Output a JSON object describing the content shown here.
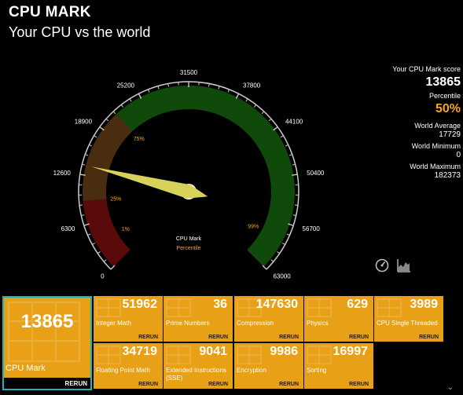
{
  "header": {
    "title": "CPU MARK",
    "subtitle": "Your CPU vs the world"
  },
  "gauge": {
    "min": 0,
    "max": 63000,
    "tick_labels": [
      "0",
      "6300",
      "12600",
      "18900",
      "25200",
      "31500",
      "37800",
      "44100",
      "50400",
      "56700",
      "63000"
    ],
    "percentile_marks": [
      {
        "label": "1%",
        "value": 3400
      },
      {
        "label": "25%",
        "value": 9300
      },
      {
        "label": "75%",
        "value": 21500
      },
      {
        "label": "99%",
        "value": 59000
      }
    ],
    "needle_value": 13865,
    "center_label": "CPU Mark",
    "center_sublabel": "Percentile",
    "colors": {
      "low": "#5a0a0a",
      "mid": "#4a2c10",
      "high": "#0f4a0a",
      "needle": "#d9d25a",
      "percent_text": "#f5a623"
    }
  },
  "score": {
    "score_label": "Your CPU Mark score",
    "score_value": "13865",
    "percentile_label": "Percentile",
    "percentile_value": "50%",
    "world_avg_label": "World Average",
    "world_avg_value": "17729",
    "world_min_label": "World Minimum",
    "world_min_value": "0",
    "world_max_label": "World Maximum",
    "world_max_value": "182373"
  },
  "icons": {
    "gauge_icon": "gauge-icon",
    "chart_icon": "chart-icon"
  },
  "main_tile": {
    "value": "13865",
    "label": "CPU Mark",
    "rerun": "RERUN"
  },
  "tiles": [
    {
      "value": "51962",
      "label": "Integer Math",
      "rerun": "RERUN"
    },
    {
      "value": "36",
      "label": "Prime Numbers",
      "rerun": "RERUN"
    },
    {
      "value": "147630",
      "label": "Compression",
      "rerun": "RERUN"
    },
    {
      "value": "629",
      "label": "Physics",
      "rerun": "RERUN"
    },
    {
      "value": "3989",
      "label": "CPU Single Threaded",
      "rerun": "RERUN"
    },
    {
      "value": "34719",
      "label": "Floating Point Math",
      "rerun": "RERUN"
    },
    {
      "value": "9041",
      "label": "Extended Instructions (SSE)",
      "rerun": "RERUN"
    },
    {
      "value": "9986",
      "label": "Encryption",
      "rerun": "RERUN"
    },
    {
      "value": "16997",
      "label": "Sorting",
      "rerun": "RERUN"
    }
  ]
}
